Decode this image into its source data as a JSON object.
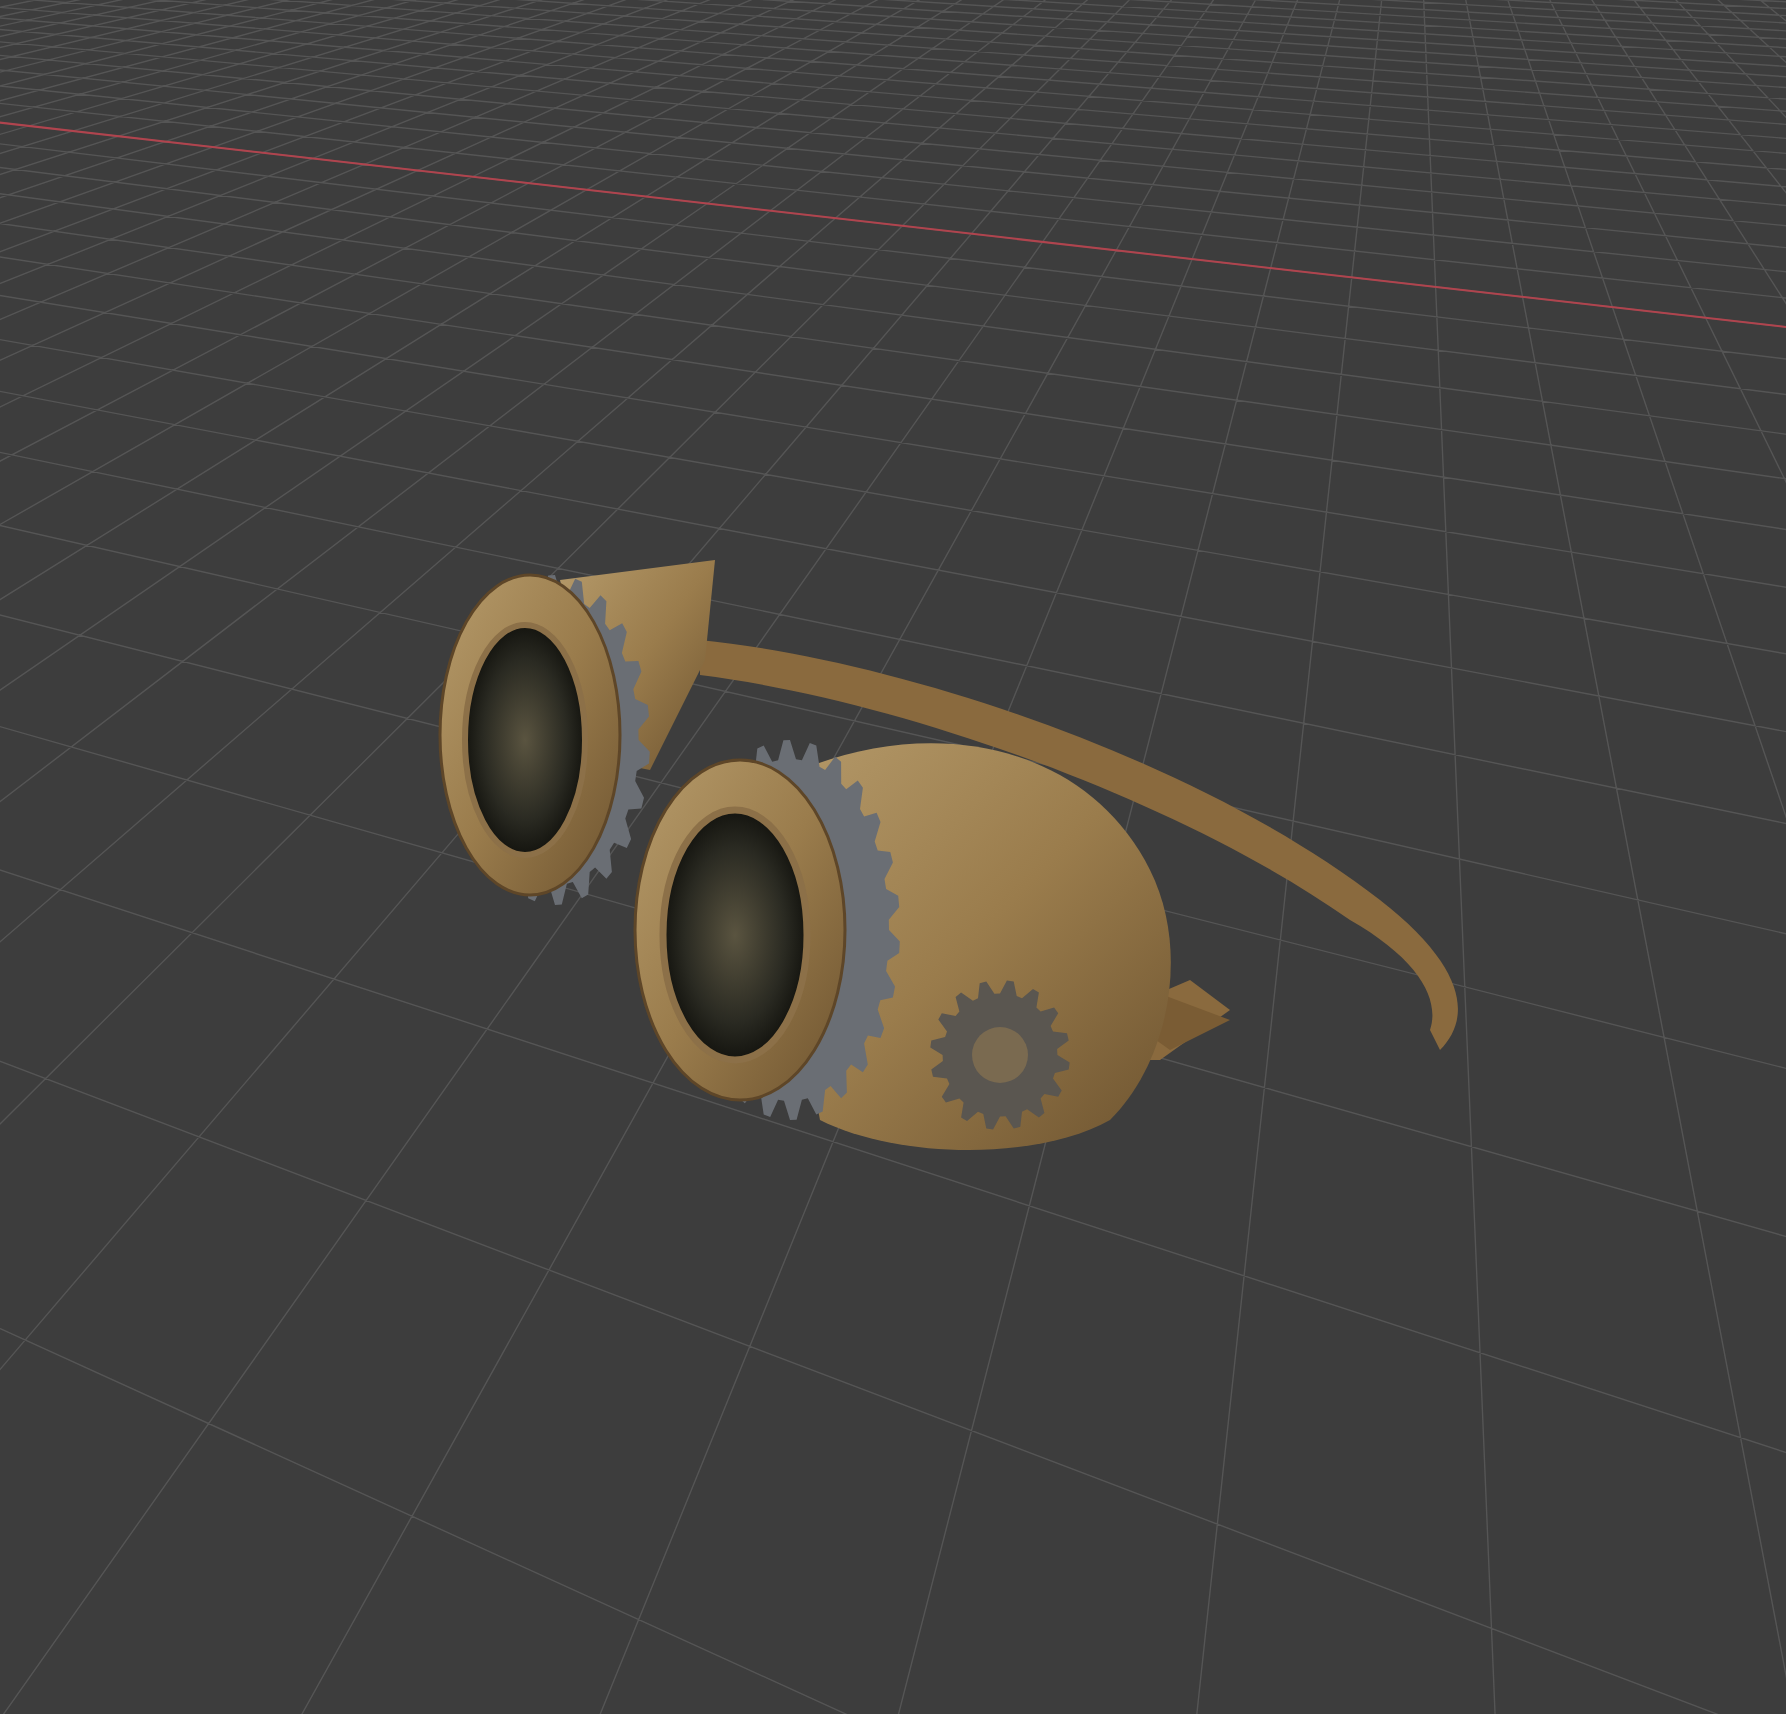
{
  "viewport": {
    "grid": true,
    "x_axis_line": true
  }
}
